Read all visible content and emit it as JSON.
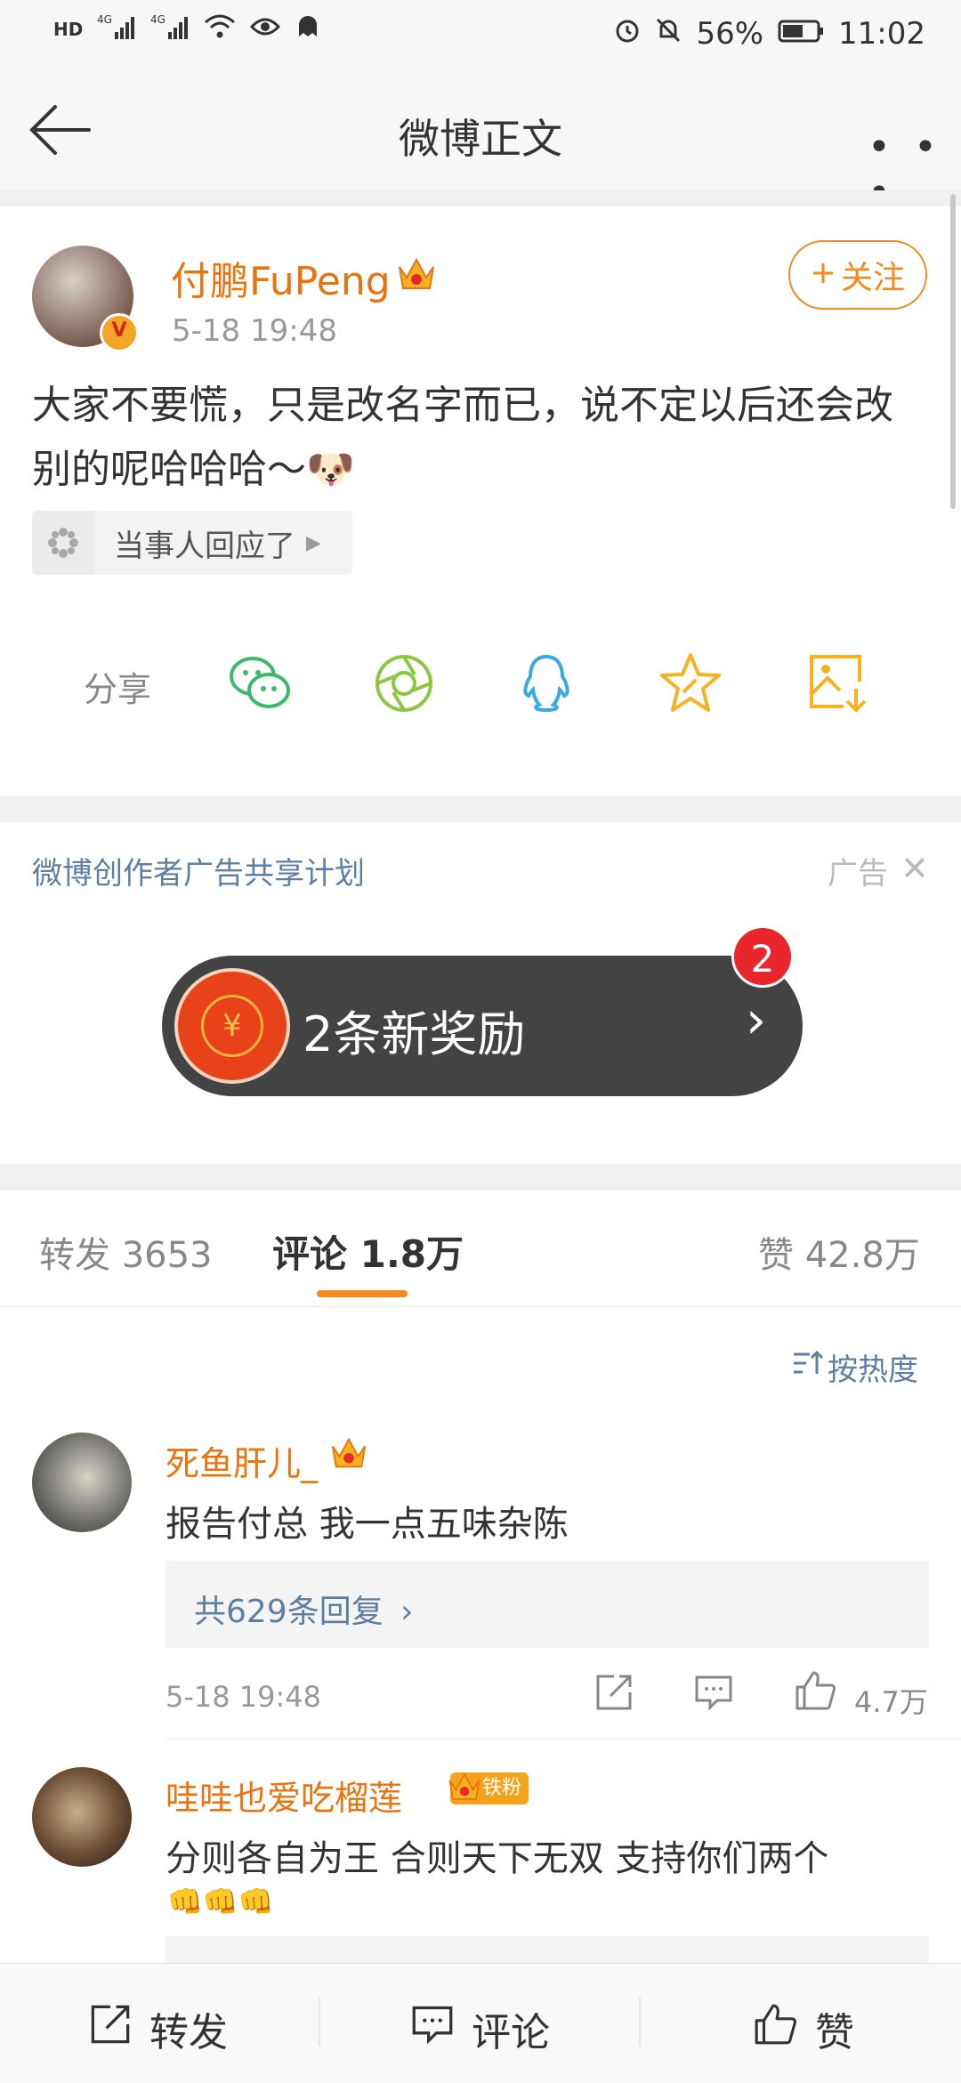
{
  "status_bar": {
    "left_icons": [
      "HD",
      "4G",
      "4G",
      "wifi-icon",
      "eye-icon",
      "ghost-icon"
    ],
    "battery": "56%",
    "time": "11:02"
  },
  "nav": {
    "title": "微博正文",
    "more": "• • •"
  },
  "post": {
    "author": "付鹏FuPeng",
    "verified_mark": "V",
    "time": "5-18 19:48",
    "follow_label": "关注",
    "text": "大家不要慌，只是改名字而已，说不定以后还会改别的呢哈哈哈～🐶",
    "topic_chip": "当事人回应了",
    "share_label": "分享"
  },
  "ad": {
    "title": "微博创作者广告共享计划",
    "tag": "广告",
    "close": "✕",
    "reward_text": "2条新奖励",
    "reward_count": "2",
    "coin_symbol": "¥",
    "arrow": "›"
  },
  "tabs": {
    "repost": "转发 3653",
    "comment": "评论 1.8万",
    "like": "赞 42.8万"
  },
  "sort_label": "按热度",
  "comments": [
    {
      "name": "死鱼肝儿_",
      "text": "报告付总 我一点五味杂陈",
      "replies": "共629条回复",
      "time": "5-18 19:48",
      "likes": "4.7万"
    },
    {
      "name": "哇哇也爱吃榴莲",
      "fan_badge": "铁粉",
      "text": "分则各自为王 合则天下无双 支持你们两个",
      "emoji": "👊👊👊"
    }
  ],
  "bottom_bar": {
    "repost": "转发",
    "comment": "评论",
    "like": "赞"
  },
  "colors": {
    "accent_orange": "#f28b1f",
    "link_blue": "#5d7fa3",
    "name_orange": "#e8730f"
  }
}
